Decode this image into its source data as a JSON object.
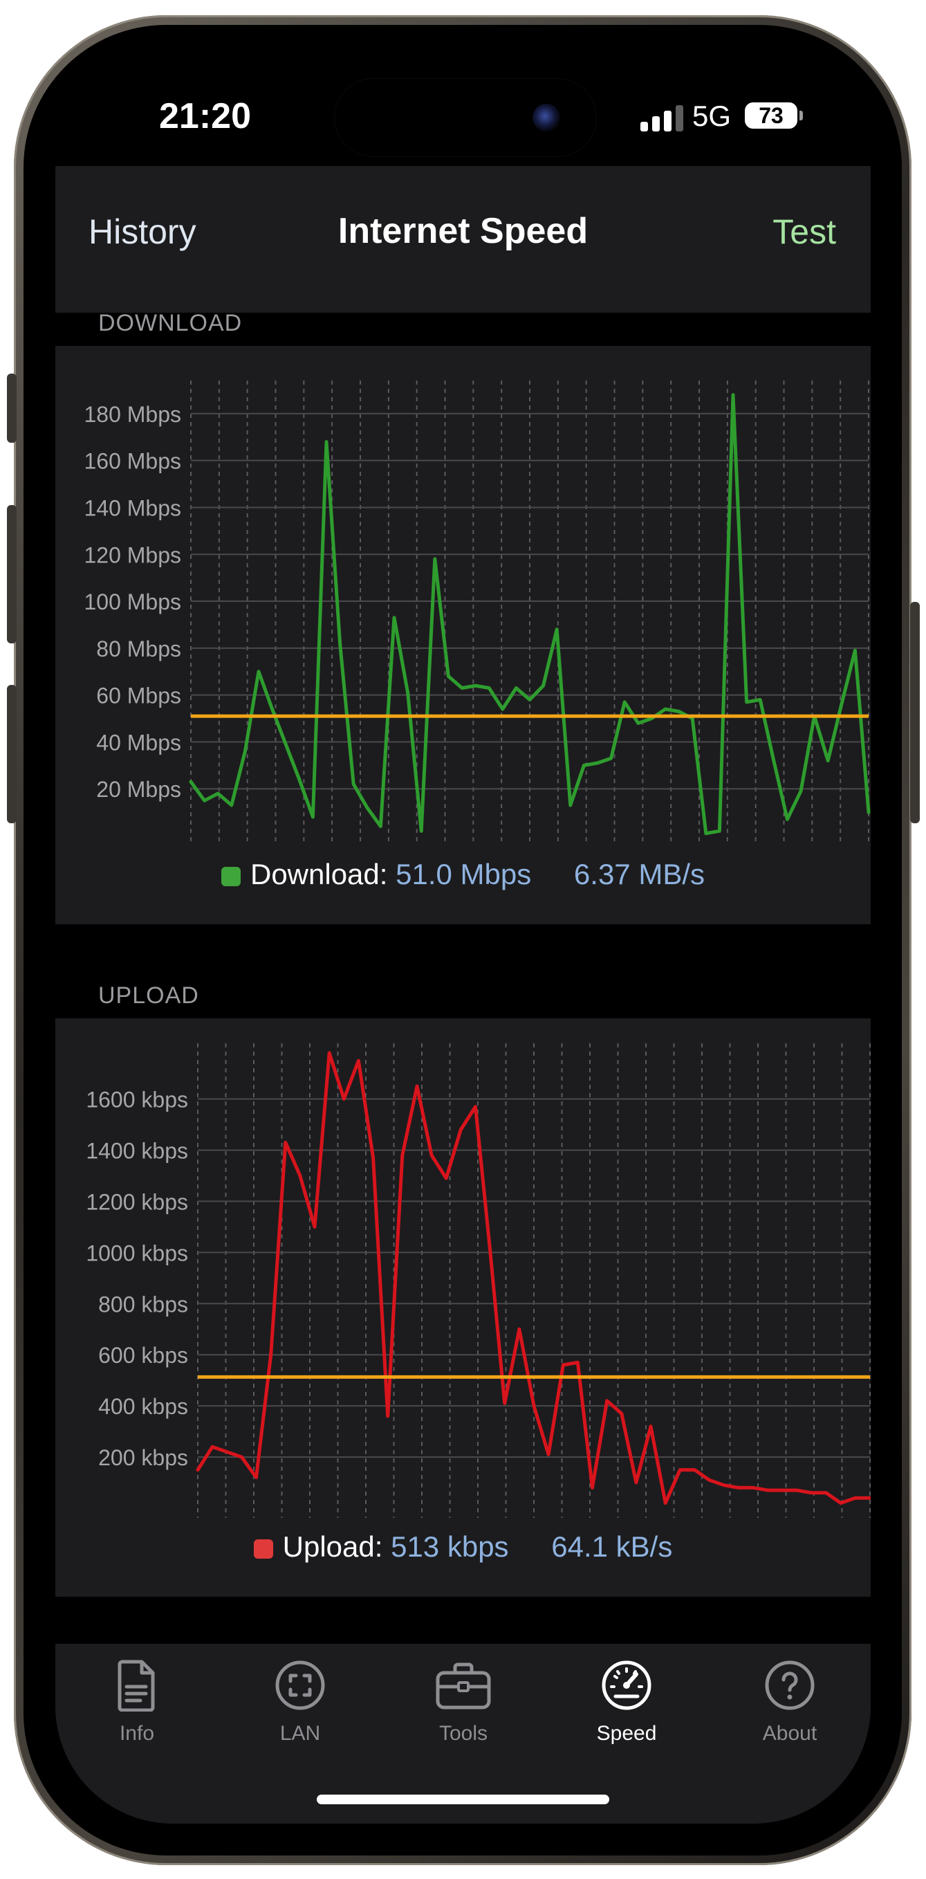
{
  "status": {
    "time": "21:20",
    "network": "5G",
    "battery": "73"
  },
  "nav": {
    "left": "History",
    "title": "Internet Speed",
    "right": "Test"
  },
  "download": {
    "section": "DOWNLOAD",
    "legend_label": "Download:",
    "speed": "51.0 Mbps",
    "rate": "6.37 MB/s",
    "color": "#2e9d2e",
    "swatch": "#3fa63b"
  },
  "upload": {
    "section": "UPLOAD",
    "legend_label": "Upload:",
    "speed": "513 kbps",
    "rate": "64.1 kB/s",
    "color": "#d8141c",
    "swatch": "#e03a3a"
  },
  "tabs": [
    {
      "label": "Info",
      "icon": "document-icon"
    },
    {
      "label": "LAN",
      "icon": "lan-scan-icon"
    },
    {
      "label": "Tools",
      "icon": "toolbox-icon"
    },
    {
      "label": "Speed",
      "icon": "speedometer-icon"
    },
    {
      "label": "About",
      "icon": "help-icon"
    }
  ],
  "colors": {
    "average_line": "#f2a516",
    "accent_test": "#a6e3a1"
  },
  "chart_data": [
    {
      "type": "line",
      "series": [
        {
          "values": [
            23,
            15,
            18,
            13,
            36,
            70,
            54,
            39,
            24,
            8,
            168,
            82,
            22,
            12,
            4,
            93,
            61,
            2,
            118,
            68,
            63,
            64,
            63,
            54,
            63,
            58,
            64,
            88,
            13,
            30,
            31,
            33,
            57,
            48,
            50,
            54,
            53,
            50,
            1,
            2,
            188,
            57,
            58,
            32,
            7,
            19,
            51,
            32,
            56,
            79,
            10
          ]
        }
      ],
      "average": 51,
      "ylim": [
        0,
        190
      ],
      "yticks": [
        "20 Mbps",
        "40 Mbps",
        "60 Mbps",
        "80 Mbps",
        "100 Mbps",
        "120 Mbps",
        "140 Mbps",
        "160 Mbps",
        "180 Mbps"
      ],
      "ytick_values": [
        20,
        40,
        60,
        80,
        100,
        120,
        140,
        160,
        180
      ],
      "grid": true
    },
    {
      "type": "line",
      "series": [
        {
          "values": [
            150,
            240,
            220,
            200,
            120,
            600,
            1430,
            1300,
            1100,
            1780,
            1600,
            1750,
            1370,
            360,
            1380,
            1650,
            1380,
            1290,
            1480,
            1570,
            1010,
            410,
            700,
            400,
            210,
            560,
            570,
            80,
            420,
            370,
            100,
            320,
            20,
            150,
            150,
            110,
            90,
            80,
            80,
            70,
            70,
            70,
            60,
            60,
            20,
            40,
            40
          ]
        }
      ],
      "average": 513,
      "ylim": [
        0,
        1780
      ],
      "yticks": [
        "200 kbps",
        "400 kbps",
        "600 kbps",
        "800 kbps",
        "1000 kbps",
        "1200 kbps",
        "1400 kbps",
        "1600 kbps"
      ],
      "ytick_values": [
        200,
        400,
        600,
        800,
        1000,
        1200,
        1400,
        1600
      ],
      "grid": true
    }
  ]
}
